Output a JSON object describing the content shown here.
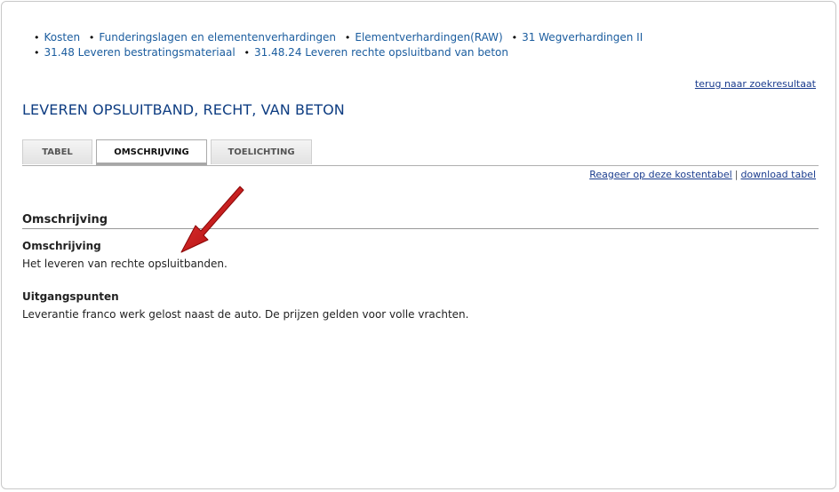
{
  "breadcrumb": {
    "items": [
      {
        "label": "Kosten"
      },
      {
        "label": "Funderingslagen en elementenverhardingen"
      },
      {
        "label": "Elementverhardingen(RAW)"
      },
      {
        "label": "31 Wegverhardingen II"
      },
      {
        "label": "31.48 Leveren bestratingsmateriaal"
      },
      {
        "label": "31.48.24 Leveren rechte opsluitband van beton"
      }
    ]
  },
  "back_link": "terug naar zoekresultaat",
  "page_title": "LEVEREN OPSLUITBAND, RECHT, VAN BETON",
  "tabs": [
    {
      "label": "TABEL",
      "active": false
    },
    {
      "label": "OMSCHRIJVING",
      "active": true
    },
    {
      "label": "TOELICHTING",
      "active": false
    }
  ],
  "tab_links": {
    "react": "Reageer op deze kostentabel",
    "separator": "|",
    "download": "download tabel"
  },
  "content": {
    "section_heading": "Omschrijving",
    "blocks": [
      {
        "heading": "Omschrijving",
        "text": "Het leveren van rechte opsluitbanden."
      },
      {
        "heading": "Uitgangspunten",
        "text": "Leverantie franco werk gelost naast de auto. De prijzen gelden voor volle vrachten."
      }
    ]
  },
  "annotation": {
    "icon": "red-arrow-icon",
    "color": "#c81414"
  }
}
